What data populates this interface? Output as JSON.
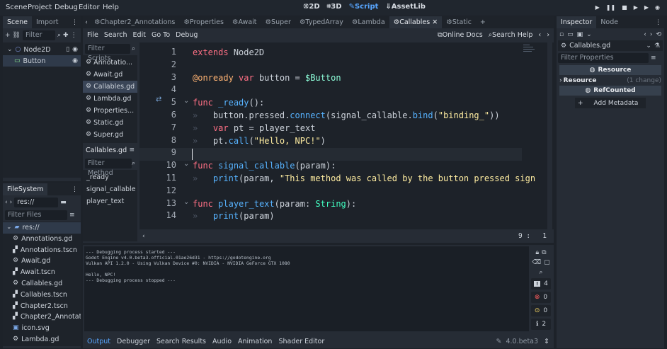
{
  "menubar": {
    "items": [
      "Scene",
      "Project",
      "Debug",
      "Editor",
      "Help"
    ],
    "modes": [
      "2D",
      "3D",
      "Script",
      "AssetLib"
    ],
    "active_mode": "Script"
  },
  "scene_dock": {
    "tabs": [
      "Scene",
      "Import"
    ],
    "filter_placeholder": "Filter",
    "tree": [
      {
        "label": "Node2D",
        "level": 0
      },
      {
        "label": "Button",
        "level": 1
      }
    ]
  },
  "filesystem": {
    "tab": "FileSystem",
    "path": "res://",
    "filter_placeholder": "Filter Files",
    "items": [
      {
        "label": "res://",
        "type": "folder",
        "level": 0
      },
      {
        "label": "Annotations.gd",
        "type": "gd",
        "level": 1
      },
      {
        "label": "Annotations.tscn",
        "type": "tscn",
        "level": 1
      },
      {
        "label": "Await.gd",
        "type": "gd",
        "level": 1
      },
      {
        "label": "Await.tscn",
        "type": "tscn",
        "level": 1
      },
      {
        "label": "Callables.gd",
        "type": "gd",
        "level": 1
      },
      {
        "label": "Callables.tscn",
        "type": "tscn",
        "level": 1
      },
      {
        "label": "Chapter2.tscn",
        "type": "tscn",
        "level": 1
      },
      {
        "label": "Chapter2_Annotatic",
        "type": "tscn",
        "level": 1
      },
      {
        "label": "icon.svg",
        "type": "svg",
        "level": 1
      },
      {
        "label": "Lambda.gd",
        "type": "gd",
        "level": 1
      }
    ]
  },
  "script_tabs": {
    "tabs": [
      "Chapter2_Annotations",
      "Properties",
      "Await",
      "Super",
      "TypedArray",
      "Lambda",
      "Callables",
      "Static"
    ],
    "active": "Callables",
    "add": "+"
  },
  "script_menu": {
    "items": [
      "File",
      "Search",
      "Edit",
      "Go To",
      "Debug"
    ],
    "online_docs": "Online Docs",
    "search_help": "Search Help"
  },
  "script_list": {
    "filter_placeholder": "Filter Scripts",
    "items": [
      "Annotatio...",
      "Await.gd",
      "Callables.gd",
      "Lambda.gd",
      "Properties...",
      "Static.gd",
      "Super.gd"
    ],
    "selected": "Callables.gd",
    "current_file": "Callables.gd",
    "method_filter_placeholder": "Filter Method",
    "methods": [
      "_ready",
      "signal_callable",
      "player_text"
    ]
  },
  "code": {
    "lines": [
      {
        "n": "1",
        "html": "<span class='kw'>extends</span> <span class='pl'>Node2D</span>"
      },
      {
        "n": "2",
        "html": ""
      },
      {
        "n": "3",
        "html": "<span class='an'>@onready</span> <span class='kw'>var</span> <span class='pl'>button = </span><span class='nd'>$Button</span>"
      },
      {
        "n": "4",
        "html": ""
      },
      {
        "n": "5",
        "html": "<span class='kw'>func</span> <span class='fn'>_ready</span><span class='pl'>():</span>"
      },
      {
        "n": "6",
        "html": "<span class='tabmark'>»</span>   <span class='pl'>button.pressed.</span><span class='fn'>connect</span><span class='pl'>(signal_callable.</span><span class='fn'>bind</span><span class='pl'>(</span><span class='str'>\"binding_\"</span><span class='pl'>))</span>"
      },
      {
        "n": "7",
        "html": "<span class='tabmark'>»</span>   <span class='kw'>var</span> <span class='pl'>pt = player_text</span>"
      },
      {
        "n": "8",
        "html": "<span class='tabmark'>»</span>   <span class='pl'>pt.</span><span class='fn'>call</span><span class='pl'>(</span><span class='str'>\"Hello, NPC!\"</span><span class='pl'>)</span>"
      },
      {
        "n": "9",
        "html": ""
      },
      {
        "n": "10",
        "html": "<span class='kw'>func</span> <span class='fn'>signal_callable</span><span class='pl'>(param):</span>"
      },
      {
        "n": "11",
        "html": "<span class='tabmark'>»</span>   <span class='fn'>print</span><span class='pl'>(param, </span><span class='str'>\"This method was called by the button pressed sign</span>"
      },
      {
        "n": "12",
        "html": ""
      },
      {
        "n": "13",
        "html": "<span class='kw'>func</span> <span class='fn'>player_text</span><span class='pl'>(param: </span><span class='ty'>String</span><span class='pl'>):</span>"
      },
      {
        "n": "14",
        "html": "<span class='tabmark'>»</span>   <span class='fn'>print</span><span class='pl'>(param)</span>"
      }
    ],
    "cursor_pos": "9 :   1"
  },
  "output": {
    "lines": [
      "--- Debugging process started ---",
      "Godot Engine v4.0.beta3.official.01ae26d31 - https://godotengine.org",
      "Vulkan API 1.2.0 - Using Vulkan Device #0: NVIDIA - NVIDIA GeForce GTX 1080",
      " ",
      "Hello, NPC!",
      "--- Debugging process stopped ---"
    ],
    "counts": {
      "messages": "4",
      "errors": "0",
      "warnings": "0",
      "info": "2"
    }
  },
  "bottom_tabs": {
    "items": [
      "Output",
      "Debugger",
      "Search Results",
      "Audio",
      "Animation",
      "Shader Editor"
    ],
    "active": "Output",
    "version": "4.0.beta3"
  },
  "inspector": {
    "tabs": [
      "Inspector",
      "Node"
    ],
    "file": "Callables.gd",
    "filter_placeholder": "Filter Properties",
    "section_resource": "Resource",
    "resource_label": "Resource",
    "resource_change": "(1 change)",
    "section_refcounted": "RefCounted",
    "add_metadata": "Add Metadata"
  }
}
